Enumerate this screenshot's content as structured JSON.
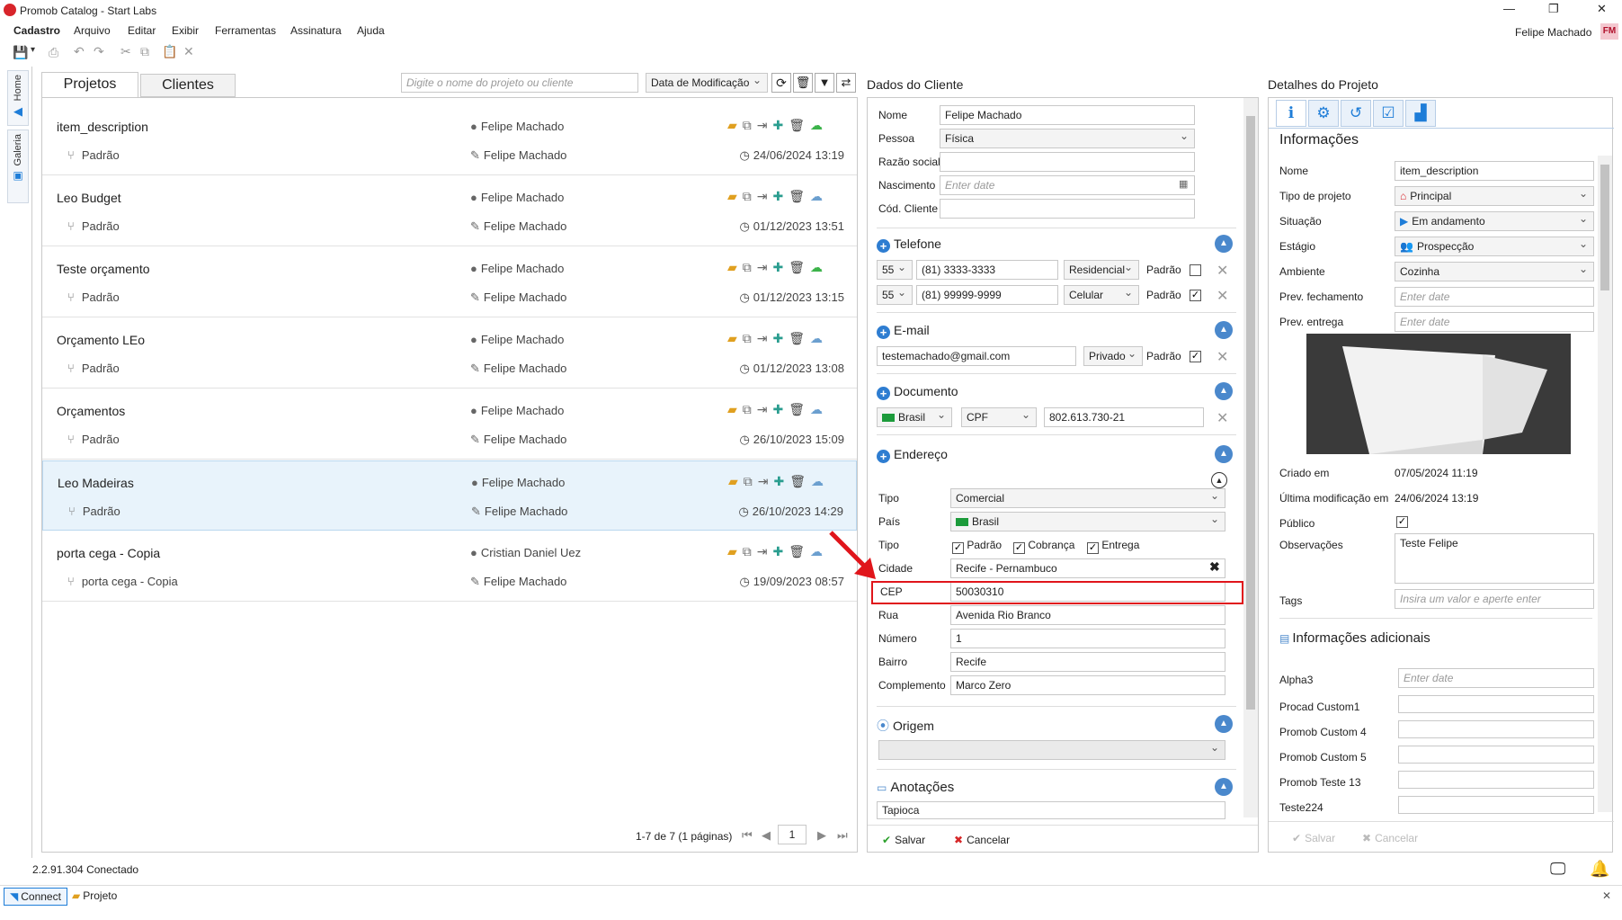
{
  "window": {
    "title": "Promob Catalog - Start Labs",
    "user_name": "Felipe Machado",
    "user_initials": "FM",
    "controls": [
      "—",
      "❐",
      "✕"
    ]
  },
  "menu": [
    "Cadastro",
    "Arquivo",
    "Editar",
    "Exibir",
    "Ferramentas",
    "Assinatura",
    "Ajuda"
  ],
  "side_tabs": [
    "Home",
    "Galeria"
  ],
  "projects_panel": {
    "tabs": [
      "Projetos",
      "Clientes"
    ],
    "search_placeholder": "Digite o nome do projeto ou cliente",
    "sort_label": "Data de Modificação",
    "rows": [
      {
        "name": "item_description",
        "owner": "Felipe Machado",
        "variant": "Padrão",
        "editor": "Felipe Machado",
        "date": "24/06/2024 13:19",
        "cloud": "green"
      },
      {
        "name": "Leo Budget",
        "owner": "Felipe Machado",
        "variant": "Padrão",
        "editor": "Felipe Machado",
        "date": "01/12/2023 13:51",
        "cloud": "blue"
      },
      {
        "name": "Teste orçamento",
        "owner": "Felipe Machado",
        "variant": "Padrão",
        "editor": "Felipe Machado",
        "date": "01/12/2023 13:15",
        "cloud": "green"
      },
      {
        "name": "Orçamento LEo",
        "owner": "Felipe Machado",
        "variant": "Padrão",
        "editor": "Felipe Machado",
        "date": "01/12/2023 13:08",
        "cloud": "blue"
      },
      {
        "name": "Orçamentos",
        "owner": "Felipe Machado",
        "variant": "Padrão",
        "editor": "Felipe Machado",
        "date": "26/10/2023 15:09",
        "cloud": "blue"
      },
      {
        "name": "Leo Madeiras",
        "owner": "Felipe Machado",
        "variant": "Padrão",
        "editor": "Felipe Machado",
        "date": "26/10/2023 14:29",
        "cloud": "blue"
      },
      {
        "name": "porta cega - Copia",
        "owner": "Cristian Daniel Uez",
        "variant": "porta cega - Copia",
        "editor": "Felipe Machado",
        "date": "19/09/2023 08:57",
        "cloud": "blue"
      }
    ],
    "pagination": {
      "summary": "1-7 de 7 (1 páginas)",
      "page": "1"
    }
  },
  "client_panel": {
    "title": "Dados do Cliente",
    "fields": {
      "nome_label": "Nome",
      "nome": "Felipe Machado",
      "pessoa_label": "Pessoa",
      "pessoa": "Física",
      "razao_label": "Razão social",
      "nasc_label": "Nascimento",
      "nasc_ph": "Enter date",
      "cod_label": "Cód. Cliente"
    },
    "telefone": {
      "title": "Telefone",
      "rows": [
        {
          "ddi": "55",
          "number": "(81) 3333-3333",
          "type": "Residencial",
          "padrao": "Padrão",
          "checked": ""
        },
        {
          "ddi": "55",
          "number": "(81) 99999-9999",
          "type": "Celular",
          "padrao": "Padrão",
          "checked": "✓"
        }
      ]
    },
    "email": {
      "title": "E-mail",
      "value": "testemachado@gmail.com",
      "type": "Privado",
      "padrao": "Padrão",
      "checked": "✓"
    },
    "documento": {
      "title": "Documento",
      "country": "Brasil",
      "doc_type": "CPF",
      "value": "802.613.730-21"
    },
    "endereco": {
      "title": "Endereço",
      "tipo_label": "Tipo",
      "tipo": "Comercial",
      "pais_label": "País",
      "pais": "Brasil",
      "tipo2_label": "Tipo",
      "opt_padrao": "Padrão",
      "opt_cobranca": "Cobrança",
      "opt_entrega": "Entrega",
      "cidade_label": "Cidade",
      "cidade": "Recife - Pernambuco",
      "cep_label": "CEP",
      "cep": "50030310",
      "rua_label": "Rua",
      "rua": "Avenida Rio Branco",
      "numero_label": "Número",
      "numero": "1",
      "bairro_label": "Bairro",
      "bairro": "Recife",
      "compl_label": "Complemento",
      "compl": "Marco Zero"
    },
    "origem": {
      "title": "Origem"
    },
    "anotacoes": {
      "title": "Anotações",
      "value": "Tapioca"
    },
    "save": "Salvar",
    "cancel": "Cancelar"
  },
  "project_panel": {
    "title": "Detalhes do Projeto",
    "section": "Informações",
    "labels": {
      "nome": "Nome",
      "tipo": "Tipo de projeto",
      "situacao": "Situação",
      "estagio": "Estágio",
      "ambiente": "Ambiente",
      "prev_fech": "Prev. fechamento",
      "prev_entrega": "Prev. entrega",
      "criado": "Criado em",
      "ultima": "Última modificação em",
      "publico": "Público",
      "obs": "Observações",
      "tags": "Tags"
    },
    "values": {
      "nome": "item_description",
      "tipo": "Principal",
      "situacao": "Em andamento",
      "estagio": "Prospecção",
      "ambiente": "Cozinha",
      "date_ph": "Enter date",
      "criado": "07/05/2024 11:19",
      "ultima": "24/06/2024 13:19",
      "publico": "✓",
      "obs": "Teste Felipe",
      "tags_ph": "Insira um valor e aperte enter"
    },
    "extra": {
      "title": "Informações adicionais",
      "fields": [
        "Alpha3",
        "Procad Custom1",
        "Promob Custom 4",
        "Promob Custom 5",
        "Promob Teste 13",
        "Teste224"
      ],
      "alpha_ph": "Enter date"
    },
    "save": "Salvar",
    "cancel": "Cancelar"
  },
  "status": {
    "version": "2.2.91.304",
    "state": "Conectado",
    "connect": "Connect",
    "projeto": "Projeto"
  },
  "colors": {
    "accent": "#1e7dd8",
    "highlight": "#e0151b",
    "selection": "#e8f3fb"
  }
}
